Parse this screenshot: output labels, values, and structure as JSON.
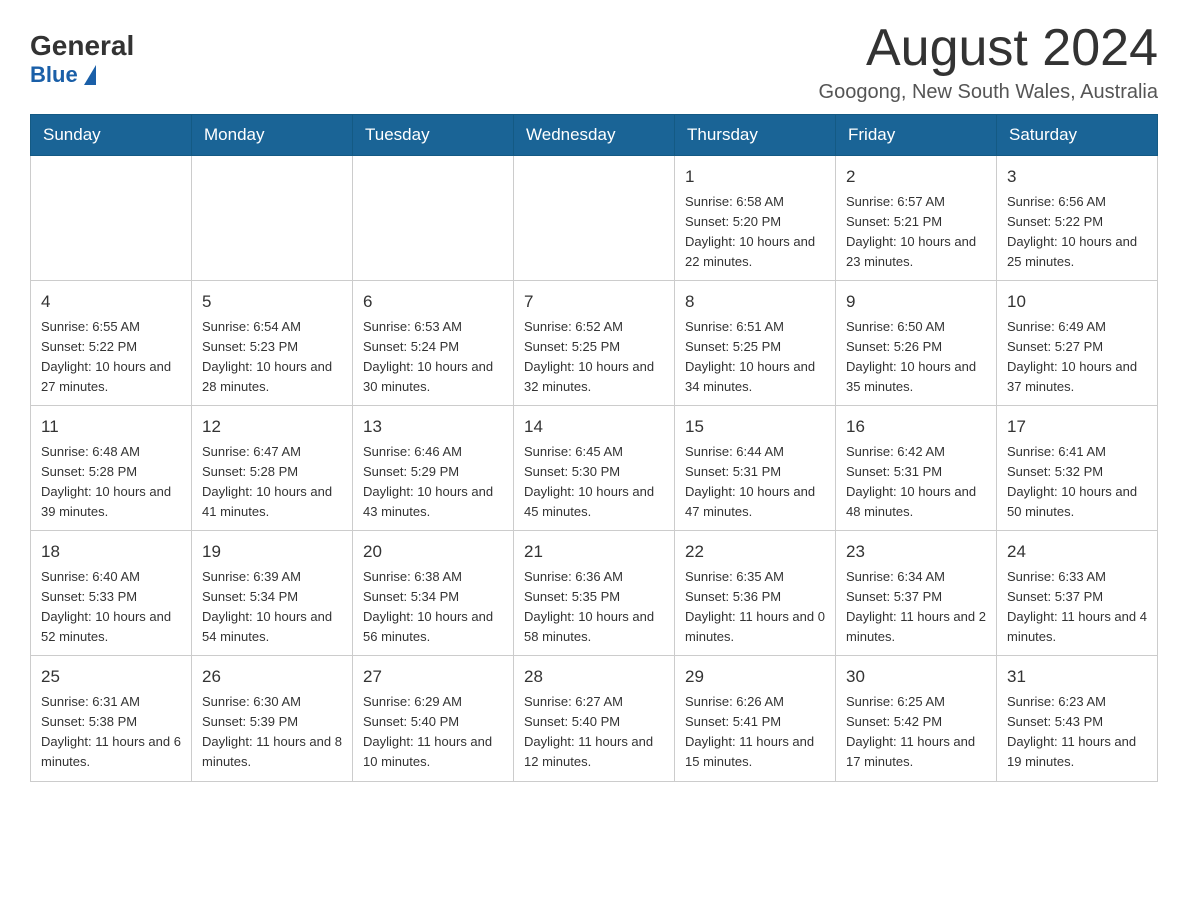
{
  "header": {
    "logo_general": "General",
    "logo_blue": "Blue",
    "month_title": "August 2024",
    "location": "Googong, New South Wales, Australia"
  },
  "days_of_week": [
    "Sunday",
    "Monday",
    "Tuesday",
    "Wednesday",
    "Thursday",
    "Friday",
    "Saturday"
  ],
  "weeks": [
    [
      {
        "day": "",
        "info": ""
      },
      {
        "day": "",
        "info": ""
      },
      {
        "day": "",
        "info": ""
      },
      {
        "day": "",
        "info": ""
      },
      {
        "day": "1",
        "info": "Sunrise: 6:58 AM\nSunset: 5:20 PM\nDaylight: 10 hours and 22 minutes."
      },
      {
        "day": "2",
        "info": "Sunrise: 6:57 AM\nSunset: 5:21 PM\nDaylight: 10 hours and 23 minutes."
      },
      {
        "day": "3",
        "info": "Sunrise: 6:56 AM\nSunset: 5:22 PM\nDaylight: 10 hours and 25 minutes."
      }
    ],
    [
      {
        "day": "4",
        "info": "Sunrise: 6:55 AM\nSunset: 5:22 PM\nDaylight: 10 hours and 27 minutes."
      },
      {
        "day": "5",
        "info": "Sunrise: 6:54 AM\nSunset: 5:23 PM\nDaylight: 10 hours and 28 minutes."
      },
      {
        "day": "6",
        "info": "Sunrise: 6:53 AM\nSunset: 5:24 PM\nDaylight: 10 hours and 30 minutes."
      },
      {
        "day": "7",
        "info": "Sunrise: 6:52 AM\nSunset: 5:25 PM\nDaylight: 10 hours and 32 minutes."
      },
      {
        "day": "8",
        "info": "Sunrise: 6:51 AM\nSunset: 5:25 PM\nDaylight: 10 hours and 34 minutes."
      },
      {
        "day": "9",
        "info": "Sunrise: 6:50 AM\nSunset: 5:26 PM\nDaylight: 10 hours and 35 minutes."
      },
      {
        "day": "10",
        "info": "Sunrise: 6:49 AM\nSunset: 5:27 PM\nDaylight: 10 hours and 37 minutes."
      }
    ],
    [
      {
        "day": "11",
        "info": "Sunrise: 6:48 AM\nSunset: 5:28 PM\nDaylight: 10 hours and 39 minutes."
      },
      {
        "day": "12",
        "info": "Sunrise: 6:47 AM\nSunset: 5:28 PM\nDaylight: 10 hours and 41 minutes."
      },
      {
        "day": "13",
        "info": "Sunrise: 6:46 AM\nSunset: 5:29 PM\nDaylight: 10 hours and 43 minutes."
      },
      {
        "day": "14",
        "info": "Sunrise: 6:45 AM\nSunset: 5:30 PM\nDaylight: 10 hours and 45 minutes."
      },
      {
        "day": "15",
        "info": "Sunrise: 6:44 AM\nSunset: 5:31 PM\nDaylight: 10 hours and 47 minutes."
      },
      {
        "day": "16",
        "info": "Sunrise: 6:42 AM\nSunset: 5:31 PM\nDaylight: 10 hours and 48 minutes."
      },
      {
        "day": "17",
        "info": "Sunrise: 6:41 AM\nSunset: 5:32 PM\nDaylight: 10 hours and 50 minutes."
      }
    ],
    [
      {
        "day": "18",
        "info": "Sunrise: 6:40 AM\nSunset: 5:33 PM\nDaylight: 10 hours and 52 minutes."
      },
      {
        "day": "19",
        "info": "Sunrise: 6:39 AM\nSunset: 5:34 PM\nDaylight: 10 hours and 54 minutes."
      },
      {
        "day": "20",
        "info": "Sunrise: 6:38 AM\nSunset: 5:34 PM\nDaylight: 10 hours and 56 minutes."
      },
      {
        "day": "21",
        "info": "Sunrise: 6:36 AM\nSunset: 5:35 PM\nDaylight: 10 hours and 58 minutes."
      },
      {
        "day": "22",
        "info": "Sunrise: 6:35 AM\nSunset: 5:36 PM\nDaylight: 11 hours and 0 minutes."
      },
      {
        "day": "23",
        "info": "Sunrise: 6:34 AM\nSunset: 5:37 PM\nDaylight: 11 hours and 2 minutes."
      },
      {
        "day": "24",
        "info": "Sunrise: 6:33 AM\nSunset: 5:37 PM\nDaylight: 11 hours and 4 minutes."
      }
    ],
    [
      {
        "day": "25",
        "info": "Sunrise: 6:31 AM\nSunset: 5:38 PM\nDaylight: 11 hours and 6 minutes."
      },
      {
        "day": "26",
        "info": "Sunrise: 6:30 AM\nSunset: 5:39 PM\nDaylight: 11 hours and 8 minutes."
      },
      {
        "day": "27",
        "info": "Sunrise: 6:29 AM\nSunset: 5:40 PM\nDaylight: 11 hours and 10 minutes."
      },
      {
        "day": "28",
        "info": "Sunrise: 6:27 AM\nSunset: 5:40 PM\nDaylight: 11 hours and 12 minutes."
      },
      {
        "day": "29",
        "info": "Sunrise: 6:26 AM\nSunset: 5:41 PM\nDaylight: 11 hours and 15 minutes."
      },
      {
        "day": "30",
        "info": "Sunrise: 6:25 AM\nSunset: 5:42 PM\nDaylight: 11 hours and 17 minutes."
      },
      {
        "day": "31",
        "info": "Sunrise: 6:23 AM\nSunset: 5:43 PM\nDaylight: 11 hours and 19 minutes."
      }
    ]
  ]
}
